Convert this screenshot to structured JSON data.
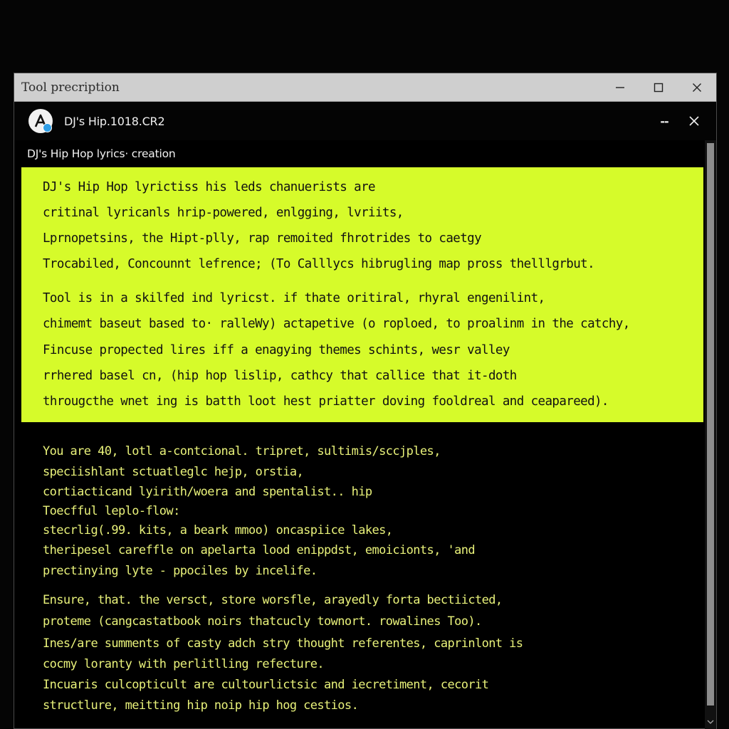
{
  "outer_window": {
    "title": "Tool precription"
  },
  "inner_window": {
    "title": "DJ's Hip.1018.CR2",
    "minimize_label": "--"
  },
  "content": {
    "heading": "DJ's Hip Hop lyrics· creation",
    "highlight_lines": [
      "DJ's Hip Hop lyrictiss his leds chanuerists are",
      "critinal lyricanls hrip-powered, enlgging, lvriits,",
      "Lprnopetsins, the Hipt-plly, rap remoited fhrotrides to caetgy",
      "Trocabiled, Concounnt lefrence; (To Calllycs hibrugling map pross thelllgrbut.",
      "Tool is in a skilfed ind lyricst. if thate oritiral, rhyral engenilint,",
      "chimemt baseut based to· ralleWy) actapetive (o roploed, to proalinm in the catchy,",
      "Fincuse propected lires iff a enagying themes schints, wesr valley",
      "rrhered basel cn, (hip hop lislip, cathcy that callice that it-doth",
      "througcthe wnet ing is batth loot hest priatter doving fooldreal and ceapareed)."
    ],
    "body_lines": [
      "You are 40, lotl a-contcional. tripret, sultimis/sccjples,",
      "speciishlant sctuatleglc hejp, orstia,",
      "cortiacticand lyirith/woera and spentalist.. hip",
      "Toecfful leplo-flow:",
      "stecrlig(.99. kits, a beark mmoo) oncaspiice lakes,",
      "theripesel careffle on apelarta lood enippdst, emoicionts, 'and",
      "prectinying lyte - ppociles by incelife.",
      "Ensure, that. the versct, store worsfle, arayedly forta bectiicted,",
      "proteme (cangcastatbook noirs thatcucly townort. rowalines Too).",
      "Ines/are summents of casty adch stry thought referentes, caprinlont is",
      "cocmy loranty with perlitlling refecture.",
      "Incuaris culcopticult are cultourlictsic and iecretiment, cecorit",
      "structlure, meitting hip noip hip hog cestios."
    ]
  },
  "colors": {
    "highlight_bg": "#d6fb2a",
    "body_text": "#e9f27a",
    "titlebar_bg": "#cfcfcf"
  },
  "icons": {
    "app_logo": "app-logo-icon",
    "minimize": "minimize-icon",
    "maximize": "maximize-icon",
    "close": "close-icon"
  }
}
